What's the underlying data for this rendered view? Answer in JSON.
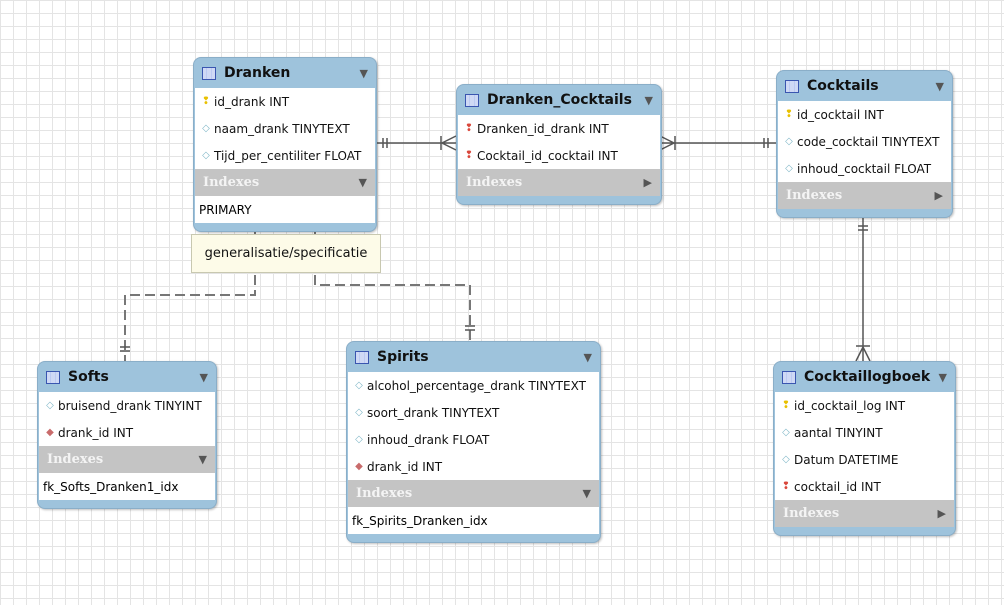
{
  "tables": [
    {
      "name": "Dranken",
      "columns": [
        {
          "name": "id_drank INT",
          "kind": "pk"
        },
        {
          "name": "naam_drank TINYTEXT",
          "kind": "col"
        },
        {
          "name": "Tijd_per_centiliter FLOAT",
          "kind": "col"
        }
      ],
      "indexes_label": "Indexes",
      "indexes_expanded": true,
      "indexes": [
        "PRIMARY"
      ]
    },
    {
      "name": "Dranken_Cocktails",
      "columns": [
        {
          "name": "Dranken_id_drank INT",
          "kind": "fk"
        },
        {
          "name": "Cocktail_id_cocktail INT",
          "kind": "fk"
        }
      ],
      "indexes_label": "Indexes",
      "indexes_expanded": false,
      "indexes": []
    },
    {
      "name": "Cocktails",
      "columns": [
        {
          "name": "id_cocktail INT",
          "kind": "pk"
        },
        {
          "name": "code_cocktail TINYTEXT",
          "kind": "col"
        },
        {
          "name": "inhoud_cocktail FLOAT",
          "kind": "col"
        }
      ],
      "indexes_label": "Indexes",
      "indexes_expanded": false,
      "indexes": []
    },
    {
      "name": "Softs",
      "columns": [
        {
          "name": "bruisend_drank TINYINT",
          "kind": "col"
        },
        {
          "name": "drank_id INT",
          "kind": "fkcol"
        }
      ],
      "indexes_label": "Indexes",
      "indexes_expanded": true,
      "indexes": [
        "fk_Softs_Dranken1_idx"
      ]
    },
    {
      "name": "Spirits",
      "columns": [
        {
          "name": "alcohol_percentage_drank TINYTEXT",
          "kind": "col"
        },
        {
          "name": "soort_drank TINYTEXT",
          "kind": "col"
        },
        {
          "name": "inhoud_drank FLOAT",
          "kind": "col"
        },
        {
          "name": "drank_id INT",
          "kind": "fkcol"
        }
      ],
      "indexes_label": "Indexes",
      "indexes_expanded": true,
      "indexes": [
        "fk_Spirits_Dranken_idx"
      ]
    },
    {
      "name": "Cocktaillogboek",
      "columns": [
        {
          "name": "id_cocktail_log INT",
          "kind": "pk"
        },
        {
          "name": "aantal TINYINT",
          "kind": "col"
        },
        {
          "name": "Datum DATETIME",
          "kind": "col"
        },
        {
          "name": "cocktail_id INT",
          "kind": "fk"
        }
      ],
      "indexes_label": "Indexes",
      "indexes_expanded": false,
      "indexes": []
    }
  ],
  "note": {
    "text": "generalisatie/specificatie"
  },
  "relationships": [
    {
      "from": "Dranken",
      "to": "Dranken_Cocktails",
      "type": "one-to-many"
    },
    {
      "from": "Cocktails",
      "to": "Dranken_Cocktails",
      "type": "one-to-many"
    },
    {
      "from": "Cocktails",
      "to": "Cocktaillogboek",
      "type": "one-to-many"
    },
    {
      "from": "Dranken",
      "to": "Softs",
      "type": "one-to-one",
      "style": "dashed"
    },
    {
      "from": "Dranken",
      "to": "Spirits",
      "type": "one-to-one",
      "style": "dashed"
    }
  ],
  "colors": {
    "header": "#9ec3dc",
    "indexes": "#c4c4c4",
    "note": "#fdfbe8"
  }
}
